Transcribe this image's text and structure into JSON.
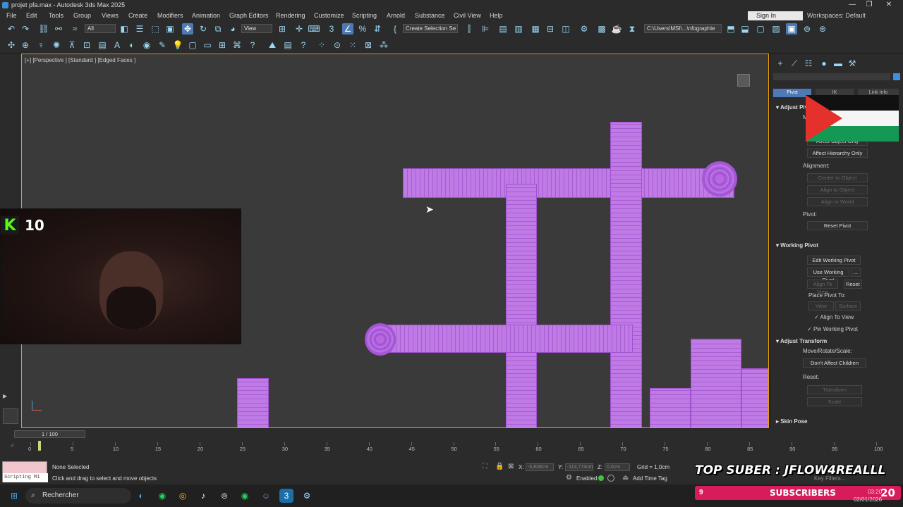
{
  "window": {
    "title": "projet pfa.max - Autodesk 3ds Max 2025",
    "controls": [
      "—",
      "❐",
      "✕"
    ]
  },
  "menu": {
    "items": [
      "File",
      "Edit",
      "Tools",
      "Group",
      "Views",
      "Create",
      "Modifiers",
      "Animation",
      "Graph Editors",
      "Rendering",
      "Customize",
      "Scripting",
      "Arnold",
      "Substance",
      "Civil View",
      "Help"
    ],
    "sign_in": "Sign In",
    "workspaces_label": "Workspaces:",
    "workspaces_value": "Default"
  },
  "toolbar": {
    "filter_value": "All",
    "ref_coord_value": "View",
    "selection_set_placeholder": "Create Selection Se",
    "path_value": "C:\\Users\\MSI\\...\\nfographie"
  },
  "viewport": {
    "label": "[+] [Perspective ] [Standard ] [Edged Faces ]",
    "object_color": "#c07ae6",
    "border_color": "#e8a000"
  },
  "stream": {
    "kick_logo": "K",
    "kick_count": "10",
    "top_suber": "TOP SUBER : JFLOW4REALLL",
    "subscribers_count": "9",
    "subscribers_label": "SUBSCRIBERS",
    "subscribers_goal": "20"
  },
  "panel": {
    "tabs": [
      "Pivot",
      "IK",
      "Link Info"
    ],
    "adjust_pivot": {
      "title": "Adjust Pivot",
      "move_rotate": "M",
      "buttons": [
        "Affect Object Only",
        "Affect Hierarchy Only"
      ],
      "alignment_label": "Alignment:",
      "align_buttons": [
        "Center to Object",
        "Align to Object",
        "Align to World"
      ],
      "pivot_label": "Pivot:",
      "reset_pivot": "Reset Pivot"
    },
    "working_pivot": {
      "title": "Working Pivot",
      "edit": "Edit Working Pivot",
      "use": "Use Working Pivot",
      "use_more": "...",
      "align_to_view": "Align To View",
      "reset": "Reset",
      "place_to": "Place Pivot To:",
      "view": "View",
      "surface": "Surface",
      "align_to_view_check": "Align To View",
      "pin_working_pivot": "Pin Working Pivot"
    },
    "adjust_transform": {
      "title": "Adjust Transform",
      "move_rotate_scale": "Move/Rotate/Scale:",
      "dont_affect_children": "Don't Affect Children",
      "reset_label": "Reset:",
      "transform": "Transform",
      "scale": "Scale"
    },
    "skin_pose": {
      "title": "Skin Pose"
    }
  },
  "timeline": {
    "frame_counter": "1 / 100",
    "ticks": [
      "0",
      "5",
      "10",
      "15",
      "20",
      "25",
      "30",
      "35",
      "40",
      "45",
      "50",
      "55",
      "60",
      "65",
      "70",
      "75",
      "80",
      "85",
      "90",
      "95",
      "100"
    ]
  },
  "status": {
    "script_label": "Scripting Mi",
    "selection": "None Selected",
    "prompt": "Click and drag to select and move objects",
    "x_label": "X:",
    "x_value": "-5,838cm",
    "y_label": "Y:",
    "y_value": "-113,774cm",
    "z_label": "Z:",
    "z_value": "0,0cm",
    "grid": "Grid = 1,0cm",
    "enabled_label": "Enabled:",
    "add_time_tag": "Add Time Tag",
    "key_filters": "Key Filters..."
  },
  "taskbar": {
    "search_placeholder": "Rechercher",
    "time": "03:20",
    "date": "02/01/2026"
  }
}
